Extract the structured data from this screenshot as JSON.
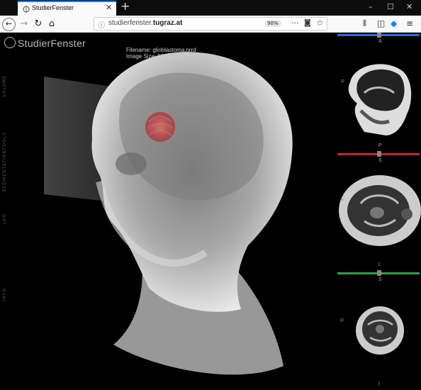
{
  "browser": {
    "tab_title": "StudierFenster",
    "new_tab": "+",
    "url_host": "studierfenster.",
    "url_domain": "tugraz.at",
    "zoom": "90%",
    "minimize": "–",
    "maximize": "☐",
    "close": "✕",
    "back": "←",
    "forward": "→",
    "reload": "↻",
    "home": "⌂",
    "more": "···"
  },
  "app": {
    "brand": "StudierFenster",
    "filename_line": "Filename: glioblastoma.nrrd",
    "size_line": "Image Size: 512,512,173",
    "left_nav": [
      "VOLUME",
      "TOOLS",
      "SEGMENTATION",
      "LOG",
      "INFO"
    ]
  },
  "views": {
    "sagittal": {
      "top_label": "A",
      "left_label": "R",
      "bottom_label": "P",
      "color": "#2a6cd8"
    },
    "axial": {
      "top_label": "S",
      "left_label": "A",
      "bottom_label": "I",
      "color": "#c0272d"
    },
    "coronal": {
      "top_label": "S",
      "left_label": "R",
      "bottom_label": "I",
      "color": "#2ea044"
    }
  }
}
